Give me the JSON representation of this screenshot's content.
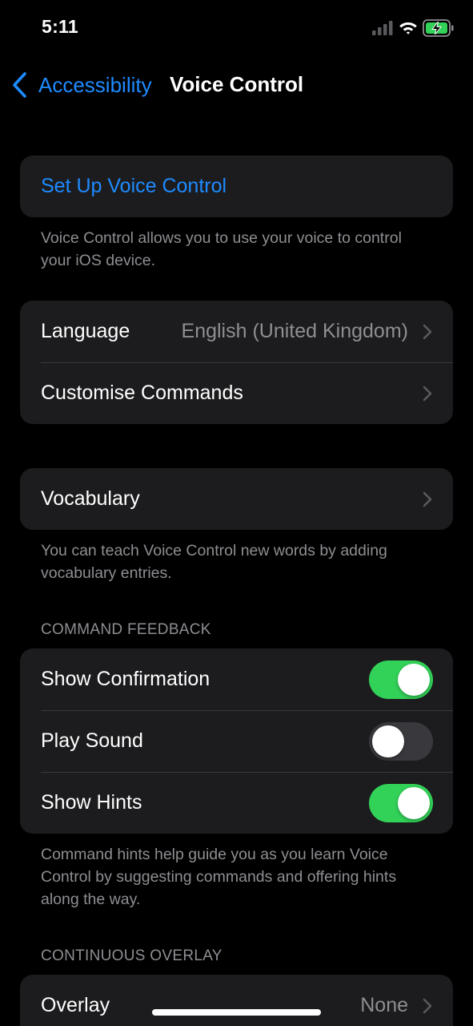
{
  "status_bar": {
    "time": "5:11",
    "signal_icon": "cellular-signal-icon",
    "wifi_icon": "wifi-icon",
    "battery_icon": "battery-charging-icon"
  },
  "nav": {
    "back_label": "Accessibility",
    "title": "Voice Control"
  },
  "setup": {
    "label": "Set Up Voice Control",
    "footer": "Voice Control allows you to use your voice to control your iOS device."
  },
  "language_group": {
    "language_label": "Language",
    "language_value": "English (United Kingdom)",
    "customise_label": "Customise Commands"
  },
  "vocabulary": {
    "label": "Vocabulary",
    "footer": "You can teach Voice Control new words by adding vocabulary entries."
  },
  "command_feedback": {
    "header": "COMMAND FEEDBACK",
    "show_confirmation_label": "Show Confirmation",
    "show_confirmation_on": true,
    "play_sound_label": "Play Sound",
    "play_sound_on": false,
    "show_hints_label": "Show Hints",
    "show_hints_on": true,
    "footer": "Command hints help guide you as you learn Voice Control by suggesting commands and offering hints along the way."
  },
  "continuous_overlay": {
    "header": "CONTINUOUS OVERLAY",
    "overlay_label": "Overlay",
    "overlay_value": "None"
  },
  "colors": {
    "accent": "#1e8bff",
    "toggle_on": "#32d158",
    "toggle_off": "#39393d",
    "cell_background": "#1c1c1e",
    "secondary_text": "#8e8e93"
  }
}
